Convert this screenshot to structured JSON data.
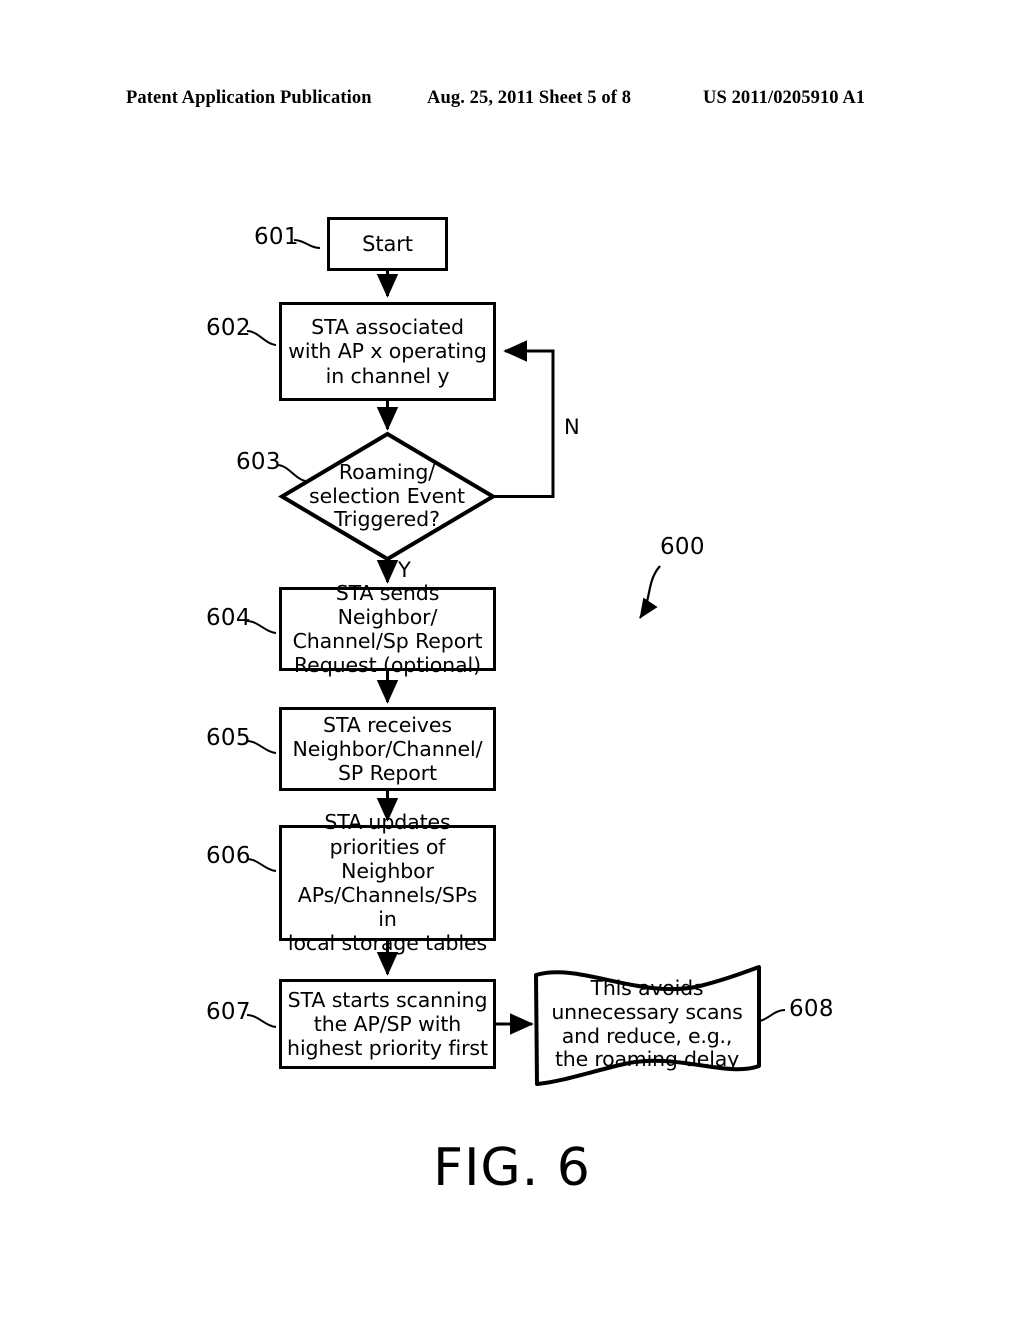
{
  "page_header": {
    "left": "Patent Application Publication",
    "center": "Aug. 25, 2011  Sheet 5 of 8",
    "right": "US 2011/0205910 A1"
  },
  "figure": {
    "caption": "FIG. 6",
    "diagram_ref": "600"
  },
  "nodes": [
    {
      "id": "601",
      "ref": "601",
      "shape": "rectangle",
      "text": "Start"
    },
    {
      "id": "602",
      "ref": "602",
      "shape": "rectangle",
      "text": "STA associated\nwith AP x operating\nin channel y"
    },
    {
      "id": "603",
      "ref": "603",
      "shape": "diamond",
      "text": "Roaming/\nselection Event\nTriggered?"
    },
    {
      "id": "604",
      "ref": "604",
      "shape": "rectangle",
      "text": "STA sends Neighbor/\nChannel/Sp Report\nRequest (optional)"
    },
    {
      "id": "605",
      "ref": "605",
      "shape": "rectangle",
      "text": "STA receives\nNeighbor/Channel/\nSP Report"
    },
    {
      "id": "606",
      "ref": "606",
      "shape": "rectangle",
      "text": "STA updates\npriorities of Neighbor\nAPs/Channels/SPs in\nlocal storage tables"
    },
    {
      "id": "607",
      "ref": "607",
      "shape": "rectangle",
      "text": "STA starts scanning\nthe AP/SP with\nhighest priority first"
    },
    {
      "id": "608",
      "ref": "608",
      "shape": "wavy-document",
      "text": "This avoids\nunnecessary scans\nand reduce, e.g.,\nthe roaming delay"
    }
  ],
  "branches": {
    "no_label": "N",
    "yes_label": "Y"
  },
  "colors": {
    "background": "#ffffff",
    "stroke": "#000000",
    "text": "#000000"
  }
}
